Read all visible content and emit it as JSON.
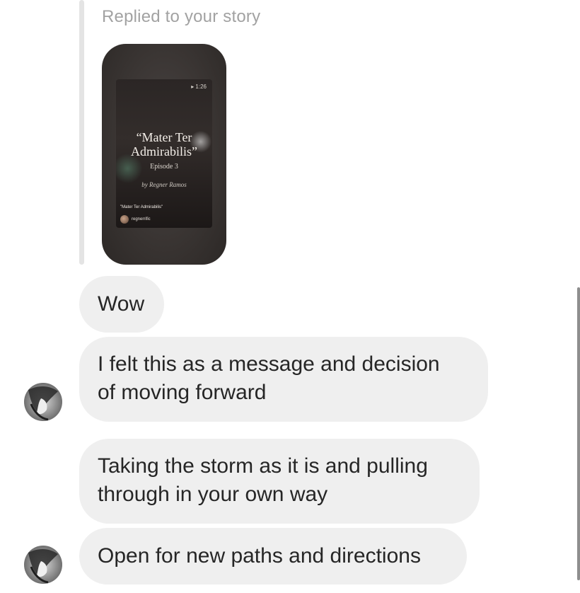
{
  "reply": {
    "label": "Replied to your story"
  },
  "story": {
    "time": "▸ 1:26",
    "title_line1": "“Mater Ter",
    "title_line2": "Admirabilis”",
    "episode": "Episode 3",
    "author": "by Regner Ramos",
    "caption": "\"Mater Ter Admirabilis\"",
    "username": "regnerrific"
  },
  "messages": [
    {
      "text": "Wow"
    },
    {
      "line1": "I felt this as a message and decision",
      "line2": "of moving forward"
    },
    {
      "line1": "Taking the storm as it is and pulling",
      "line2": "through in your own way"
    },
    {
      "text": "Open for new paths and directions"
    }
  ],
  "colors": {
    "bubble": "#efefef",
    "text": "#262626",
    "muted": "#a2a2a2"
  }
}
